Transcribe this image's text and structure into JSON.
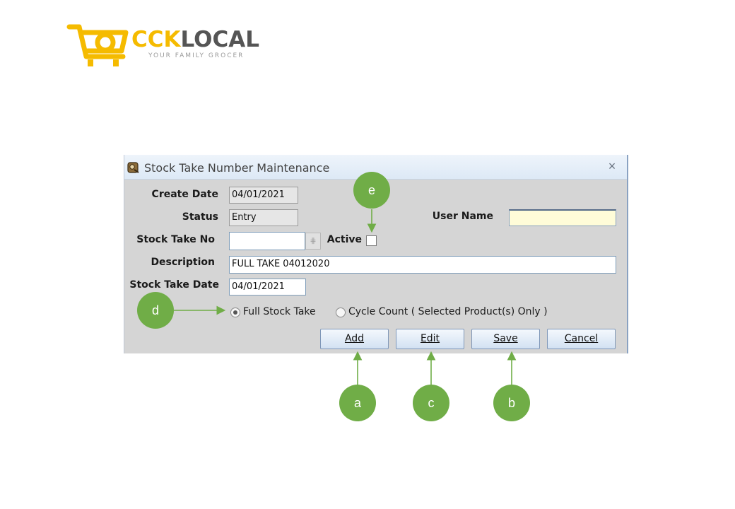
{
  "logo": {
    "brand_accent": "CCK",
    "brand_rest": "LOCAL",
    "tagline": "YOUR FAMILY GROCER",
    "colors": {
      "accent": "#f5bb00",
      "text": "#555555"
    }
  },
  "window": {
    "title": "Stock Take Number Maintenance",
    "icon": "stock-take-app-icon",
    "close_glyph": "×"
  },
  "form": {
    "create_date": {
      "label": "Create Date",
      "value": "04/01/2021"
    },
    "status": {
      "label": "Status",
      "value": "Entry"
    },
    "user_name": {
      "label": "User Name",
      "value": ""
    },
    "stock_take_no": {
      "label": "Stock Take No",
      "value": "",
      "lookup_glyph": "⋕"
    },
    "active": {
      "label": "Active",
      "checked": false
    },
    "description": {
      "label": "Description",
      "value": "FULL TAKE 04012020"
    },
    "stock_take_date": {
      "label": "Stock Take Date",
      "value": "04/01/2021"
    },
    "mode": {
      "options": [
        {
          "label": "Full Stock Take",
          "selected": true
        },
        {
          "label": "Cycle Count ( Selected Product(s) Only )",
          "selected": false
        }
      ]
    }
  },
  "buttons": {
    "add": "Add",
    "edit": "Edit",
    "save": "Save",
    "cancel": "Cancel"
  },
  "callouts": {
    "a": "a",
    "b": "b",
    "c": "c",
    "d": "d",
    "e": "e",
    "color": "#70ad47"
  }
}
